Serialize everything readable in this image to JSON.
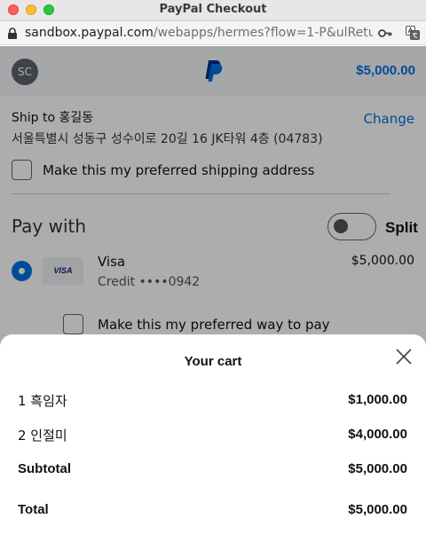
{
  "window": {
    "title": "PayPal Checkout"
  },
  "address_bar": {
    "host": "sandbox.paypal.com",
    "path": "/webapps/hermes?flow=1-P&ulReturn..."
  },
  "header": {
    "avatar_initials": "SC",
    "total": "$5,000.00",
    "brand_color": "#0070e0"
  },
  "shipping": {
    "ship_to": "Ship to 홍길동",
    "change_label": "Change",
    "address": "서울특별시 성동구 성수이로 20길 16 JK타워 4층 (04783)",
    "preferred_label": "Make this my preferred shipping address"
  },
  "payment": {
    "heading": "Pay with",
    "split_label": "Split",
    "card_logo": "VISA",
    "card_name": "Visa",
    "card_detail": "Credit ••••0942",
    "card_amount": "$5,000.00",
    "preferred_label": "Make this my preferred way to pay"
  },
  "cart": {
    "title": "Your cart",
    "items": [
      {
        "label": "1 흑임자",
        "price": "$1,000.00"
      },
      {
        "label": "2 인절미",
        "price": "$4,000.00"
      }
    ],
    "subtotal_label": "Subtotal",
    "subtotal": "$5,000.00",
    "total_label": "Total",
    "total": "$5,000.00"
  }
}
